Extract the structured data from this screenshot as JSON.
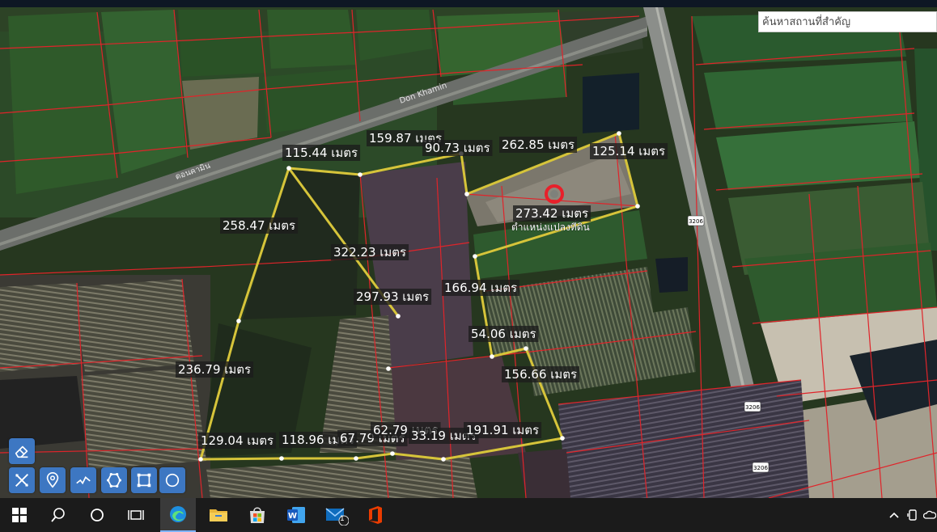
{
  "search": {
    "placeholder": "ค้นหาสถานที่สำคัญ"
  },
  "map": {
    "road_label": "Don Khamin",
    "road_label_left": "ดอนคามิน",
    "route_badge": "3206",
    "marker_caption": "ตำแหน่งแปลงที่ดิน",
    "measurements": [
      "159.87 เมตร",
      "90.73 เมตร",
      "262.85 เมตร",
      "125.14 เมตร",
      "115.44 เมตร",
      "273.42 เมตร",
      "258.47 เมตร",
      "322.23 เมตร",
      "297.93 เมตร",
      "166.94 เมตร",
      "54.06 เมตร",
      "236.79 เมตร",
      "156.66 เมตร",
      "129.04 เมตร",
      "118.96 เมตร",
      "67.79 เมตร",
      "62.79 เมตร",
      "33.19 เมตร",
      "191.91 เมตร"
    ],
    "colors": {
      "parcel_line": "#e0242a",
      "measure_line": "#d6c43a",
      "marker": "#e8202a"
    }
  },
  "tools": [
    {
      "name": "eraser-tool",
      "icon": "eraser-icon"
    },
    {
      "name": "ruler-tool",
      "icon": "ruler-icon"
    },
    {
      "name": "pin-tool",
      "icon": "location-pin-icon"
    },
    {
      "name": "line-tool",
      "icon": "polyline-icon"
    },
    {
      "name": "polygon-tool",
      "icon": "polygon-icon"
    },
    {
      "name": "rectangle-tool",
      "icon": "rectangle-icon"
    },
    {
      "name": "circle-tool",
      "icon": "circle-icon"
    }
  ],
  "taskbar": {
    "mail_badge": "1",
    "word_letter": "W"
  }
}
